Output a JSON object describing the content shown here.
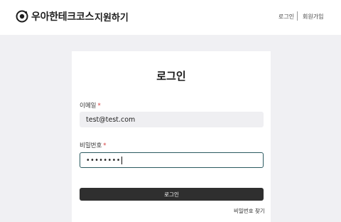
{
  "header": {
    "brand": "우아한테크코스",
    "subtitle": "지원하기",
    "nav": {
      "login": "로그인",
      "signup": "회원가입"
    }
  },
  "card": {
    "title": "로그인",
    "email": {
      "label": "이메일",
      "required_mark": "*",
      "value": "test@test.com"
    },
    "password": {
      "label": "비밀번호",
      "required_mark": "*",
      "value": "••••••••"
    },
    "submit_label": "로그인",
    "find_password": "비밀번호 찾기"
  },
  "icons": {
    "logo": "logo-icon"
  },
  "colors": {
    "background": "#f0f0f3",
    "input_focus_border": "#2b5a60",
    "button": "#2f2f2f",
    "required": "#d33b3b"
  }
}
